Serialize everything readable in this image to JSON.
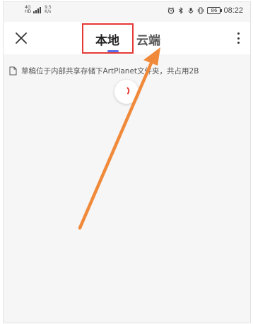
{
  "status_bar": {
    "network_badge_top": "4G",
    "network_badge_bottom": "HD",
    "speed_value": "9.5",
    "speed_unit": "K/s",
    "battery": "86",
    "time": "08:22"
  },
  "top_bar": {
    "tabs": [
      {
        "label": "本地"
      },
      {
        "label": "云端"
      }
    ]
  },
  "notice": {
    "text": "草稿位于内部共享存储下ArtPlanet文件夹，共占用2B"
  },
  "colors": {
    "accent": "#5a72e8",
    "highlight": "#e53935",
    "arrow": "#f08a3a",
    "spinner": "#e53935"
  },
  "icons": {
    "close": "close-icon",
    "more": "more-vertical-icon",
    "document": "document-icon",
    "spinner": "loading-spinner-icon"
  }
}
